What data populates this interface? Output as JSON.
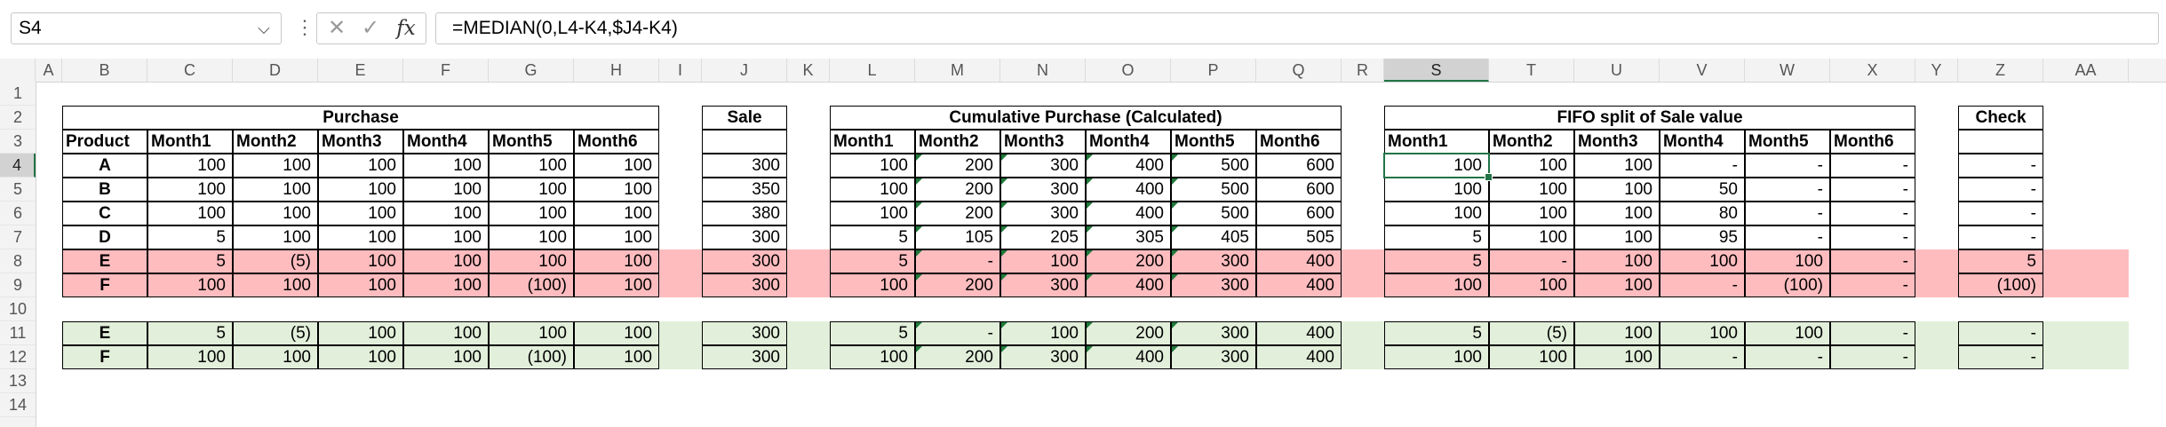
{
  "formula_bar": {
    "name_box": "S4",
    "formula": "=MEDIAN(0,L4-K4,$J4-K4)"
  },
  "columns": [
    "A",
    "B",
    "C",
    "D",
    "E",
    "F",
    "G",
    "H",
    "I",
    "J",
    "K",
    "L",
    "M",
    "N",
    "O",
    "P",
    "Q",
    "R",
    "S",
    "T",
    "U",
    "V",
    "W",
    "X",
    "Y",
    "Z",
    "AA"
  ],
  "rows": [
    "1",
    "2",
    "3",
    "4",
    "5",
    "6",
    "7",
    "8",
    "9",
    "10",
    "11",
    "12",
    "13",
    "14"
  ],
  "selected_column": "S",
  "selected_row": "4",
  "sections": {
    "purchase": "Purchase",
    "sale": "Sale",
    "cumulative": "Cumulative Purchase (Calculated)",
    "fifo": "FIFO split of Sale value",
    "check": "Check"
  },
  "headers": {
    "product": "Product",
    "months": [
      "Month1",
      "Month2",
      "Month3",
      "Month4",
      "Month5",
      "Month6"
    ]
  },
  "table": [
    {
      "product": "A",
      "purchase": [
        "100",
        "100",
        "100",
        "100",
        "100",
        "100"
      ],
      "sale": "300",
      "cumulative": [
        "100",
        "200",
        "300",
        "400",
        "500",
        "600"
      ],
      "fifo": [
        "100",
        "100",
        "100",
        "-",
        "-",
        "-"
      ],
      "check": "-"
    },
    {
      "product": "B",
      "purchase": [
        "100",
        "100",
        "100",
        "100",
        "100",
        "100"
      ],
      "sale": "350",
      "cumulative": [
        "100",
        "200",
        "300",
        "400",
        "500",
        "600"
      ],
      "fifo": [
        "100",
        "100",
        "100",
        "50",
        "-",
        "-"
      ],
      "check": "-"
    },
    {
      "product": "C",
      "purchase": [
        "100",
        "100",
        "100",
        "100",
        "100",
        "100"
      ],
      "sale": "380",
      "cumulative": [
        "100",
        "200",
        "300",
        "400",
        "500",
        "600"
      ],
      "fifo": [
        "100",
        "100",
        "100",
        "80",
        "-",
        "-"
      ],
      "check": "-"
    },
    {
      "product": "D",
      "purchase": [
        "5",
        "100",
        "100",
        "100",
        "100",
        "100"
      ],
      "sale": "300",
      "cumulative": [
        "5",
        "105",
        "205",
        "305",
        "405",
        "505"
      ],
      "fifo": [
        "5",
        "100",
        "100",
        "95",
        "-",
        "-"
      ],
      "check": "-"
    },
    {
      "product": "E",
      "purchase": [
        "5",
        "(5)",
        "100",
        "100",
        "100",
        "100"
      ],
      "sale": "300",
      "cumulative": [
        "5",
        "-",
        "100",
        "200",
        "300",
        "400"
      ],
      "fifo": [
        "5",
        "-",
        "100",
        "100",
        "100",
        "-"
      ],
      "check": "5"
    },
    {
      "product": "F",
      "purchase": [
        "100",
        "100",
        "100",
        "100",
        "(100)",
        "100"
      ],
      "sale": "300",
      "cumulative": [
        "100",
        "200",
        "300",
        "400",
        "300",
        "400"
      ],
      "fifo": [
        "100",
        "100",
        "100",
        "-",
        "(100)",
        "-"
      ],
      "check": "(100)"
    }
  ],
  "table2": [
    {
      "product": "E",
      "purchase": [
        "5",
        "(5)",
        "100",
        "100",
        "100",
        "100"
      ],
      "sale": "300",
      "cumulative": [
        "5",
        "-",
        "100",
        "200",
        "300",
        "400"
      ],
      "fifo": [
        "5",
        "(5)",
        "100",
        "100",
        "100",
        "-"
      ],
      "check": "-"
    },
    {
      "product": "F",
      "purchase": [
        "100",
        "100",
        "100",
        "100",
        "(100)",
        "100"
      ],
      "sale": "300",
      "cumulative": [
        "100",
        "200",
        "300",
        "400",
        "300",
        "400"
      ],
      "fifo": [
        "100",
        "100",
        "100",
        "-",
        "-",
        "-"
      ],
      "check": "-"
    }
  ],
  "colors": {
    "highlight_red": "#ffbcbf",
    "highlight_green": "#e2efda",
    "selection_green": "#217346",
    "error_triangle": "#1f7a3a"
  }
}
